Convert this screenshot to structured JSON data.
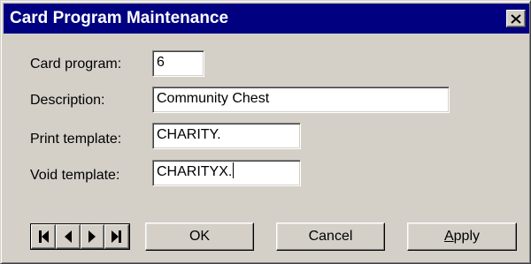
{
  "window": {
    "title": "Card Program Maintenance"
  },
  "form": {
    "card_program_label": "Card program:",
    "card_program_value": "6",
    "description_label": "Description:",
    "description_value": "Community Chest",
    "print_template_label": "Print template:",
    "print_template_value": "CHARITY.",
    "void_template_label": "Void template:",
    "void_template_value": "CHARITYX."
  },
  "navigation": {
    "icons": [
      "first-record-icon",
      "previous-record-icon",
      "next-record-icon",
      "last-record-icon"
    ]
  },
  "buttons": {
    "ok_label": "OK",
    "cancel_label": "Cancel",
    "apply_label": "Apply"
  },
  "colors": {
    "titlebar": "#000080",
    "face": "#d4d0c8",
    "field": "#ffffff"
  }
}
